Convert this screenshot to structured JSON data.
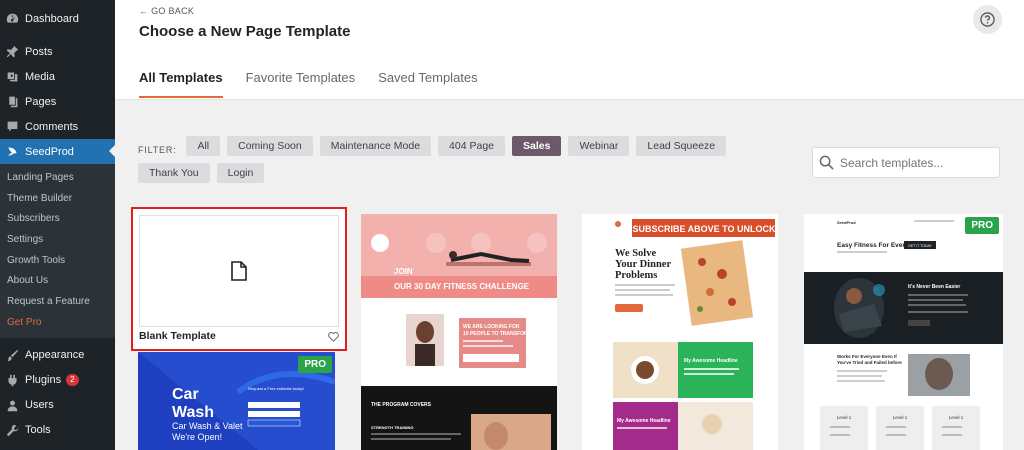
{
  "sidebar": {
    "top_items": [
      {
        "label": "Dashboard",
        "icon": "dashboard-icon"
      },
      {
        "label": "Posts",
        "icon": "pin-icon"
      },
      {
        "label": "Media",
        "icon": "media-icon"
      },
      {
        "label": "Pages",
        "icon": "pages-icon"
      },
      {
        "label": "Comments",
        "icon": "comment-icon"
      },
      {
        "label": "SeedProd",
        "icon": "seedprod-icon"
      }
    ],
    "submenu": [
      "Landing Pages",
      "Theme Builder",
      "Subscribers",
      "Settings",
      "Growth Tools",
      "About Us",
      "Request a Feature",
      "Get Pro"
    ],
    "bottom_items": [
      {
        "label": "Appearance",
        "icon": "brush-icon"
      },
      {
        "label": "Plugins",
        "icon": "plugin-icon",
        "badge": "2"
      },
      {
        "label": "Users",
        "icon": "user-icon"
      },
      {
        "label": "Tools",
        "icon": "wrench-icon"
      }
    ]
  },
  "header": {
    "go_back": "← GO BACK",
    "title": "Choose a New Page Template",
    "tabs": [
      "All Templates",
      "Favorite Templates",
      "Saved Templates"
    ]
  },
  "filters": {
    "label": "FILTER:",
    "chips": [
      "All",
      "Coming Soon",
      "Maintenance Mode",
      "404 Page",
      "Sales",
      "Webinar",
      "Lead Squeeze",
      "Thank You",
      "Login"
    ],
    "active": "Sales"
  },
  "search": {
    "placeholder": "Search templates..."
  },
  "cards": {
    "blank": {
      "label": "Blank Template"
    },
    "pro_label": "PRO",
    "fitness": {
      "heading": "JOIN\nOUR 30 DAY FITNESS CHALLENGE",
      "heading_line1": "JOIN",
      "heading_line2": "OUR 30 DAY FITNESS CHALLENGE",
      "box_text_1": "WE ARE LOOKING FOR",
      "box_text_2": "10 PEOPLE TO TRANSFORM",
      "section": "THE PROGRAM COVERS",
      "sub": "STRENGTH TRAINING"
    },
    "food": {
      "banner": "SUBSCRIBE ABOVE TO UNLOCK",
      "heading_1": "We Solve",
      "heading_2": "Your Dinner",
      "heading_3": "Problems",
      "block1": "My Awesome Headline",
      "block2": "My Awesome Headline"
    },
    "gym": {
      "brand": "SeedProd",
      "heading": "Easy Fitness For Everyone.",
      "cta": "GET IT TODAY",
      "dark_heading": "It's Never Been Easier",
      "section2_1": "Works For Everyone Even If",
      "section2_2": "You've Tried and Failed before",
      "levels": [
        "Level 1",
        "Level 1",
        "Level 1"
      ]
    },
    "car": {
      "title_1": "Car",
      "title_2": "Wash",
      "subtitle_1": "Car Wash & Valet",
      "subtitle_2": "We're Open!",
      "form_title": "Request a Free estimate today!"
    }
  },
  "colors": {
    "sidebar_bg": "#1d2327",
    "active_menu": "#2271b1",
    "accent": "#e2693a",
    "filter_active": "#6c5a6a",
    "highlight_border": "#e02020",
    "pro_green": "#2aa34a"
  }
}
